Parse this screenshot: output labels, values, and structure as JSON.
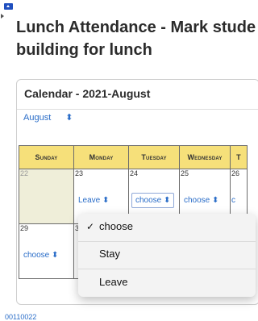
{
  "page": {
    "title_line1": "Lunch Attendance - Mark stude",
    "title_line2": "building for lunch"
  },
  "calendar": {
    "title": "Calendar - 2021-August",
    "month_select": {
      "value": "August",
      "icon": "up-down-chevron-icon"
    },
    "headers": [
      "Sunday",
      "Monday",
      "Tuesday",
      "Wednesday",
      "T"
    ],
    "week1": {
      "d22": "22",
      "d23": "23",
      "d23_value": "Leave",
      "d24": "24",
      "d24_value": "choose",
      "d25": "25",
      "d25_value": "choose",
      "d26": "26",
      "d26_value": "c"
    },
    "week2": {
      "d29": "29",
      "d29_value": "choose",
      "d30": "30"
    }
  },
  "dropdown": {
    "options": [
      {
        "label": "choose",
        "checked": true
      },
      {
        "label": "Stay"
      },
      {
        "label": "Leave"
      }
    ],
    "checkmark": "✓"
  },
  "footer": {
    "text": "00110022"
  },
  "colors": {
    "accent": "#2a6dc8",
    "header_bg": "#f6e07a",
    "past_day": "#efeed9"
  }
}
